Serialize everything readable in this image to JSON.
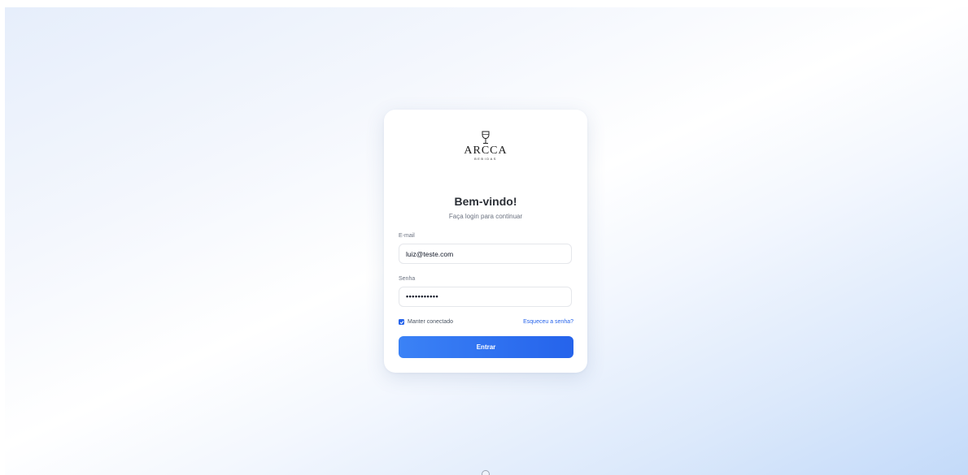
{
  "brand": {
    "name": "ARCCA",
    "tagline": "BEBIDAS",
    "logo_icon": "wine-glass-icon"
  },
  "login": {
    "title": "Bem-vindo!",
    "subtitle": "Faça login para continuar",
    "email_label": "E-mail",
    "email_value": "luiz@teste.com",
    "password_label": "Senha",
    "password_value": "•••••••••••",
    "remember_label": "Manter conectado",
    "remember_checked": true,
    "forgot_label": "Esqueceu a senha?",
    "submit_label": "Entrar"
  },
  "colors": {
    "accent": "#2563eb",
    "title": "#2b2f36"
  }
}
